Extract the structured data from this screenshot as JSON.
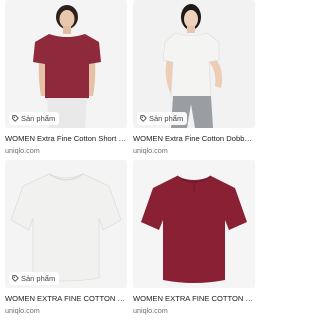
{
  "results": [
    {
      "badge": "Sản phẩm",
      "title": "WOMEN Extra Fine Cotton Short Sleeve T-Shirt",
      "source": "uniqlo.com",
      "color": "#8e2a3c",
      "model": true
    },
    {
      "badge": "Sản phẩm",
      "title": "WOMEN Extra Fine Cotton Dobby Blouse",
      "source": "uniqlo.com",
      "color": "#f4f4f2",
      "model": true
    },
    {
      "badge": "Sản phẩm",
      "title": "WOMEN EXTRA FINE COTTON SHORT SLEEVE BLOUSE",
      "source": "uniqlo.com",
      "color": "#f1f1ef",
      "model": false
    },
    {
      "badge": "",
      "title": "WOMEN EXTRA FINE COTTON SHORT SLEEVE BLOUSE",
      "source": "uniqlo.com",
      "color": "#8a2034",
      "model": false
    }
  ]
}
